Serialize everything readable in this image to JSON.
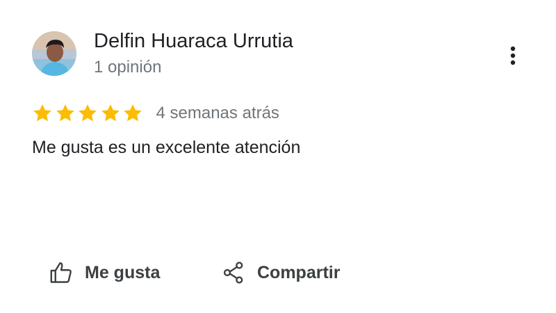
{
  "review": {
    "author": {
      "name": "Delfin Huaraca Urrutia",
      "meta": "1 opinión",
      "avatar_icon": "user-photo-avatar"
    },
    "more_icon": "more-vert-icon",
    "rating": {
      "stars": 5,
      "max": 5,
      "star_color": "#fbbc04",
      "star_icon": "star-icon"
    },
    "date": "4 semanas atrás",
    "text": "Me gusta es un excelente atención"
  },
  "actions": {
    "like": {
      "label": "Me gusta",
      "icon": "thumb-up-icon"
    },
    "share": {
      "label": "Compartir",
      "icon": "share-icon"
    }
  },
  "colors": {
    "primary_text": "#202124",
    "secondary_text": "#70757a",
    "action_text": "#3c4043",
    "star": "#fbbc04"
  }
}
